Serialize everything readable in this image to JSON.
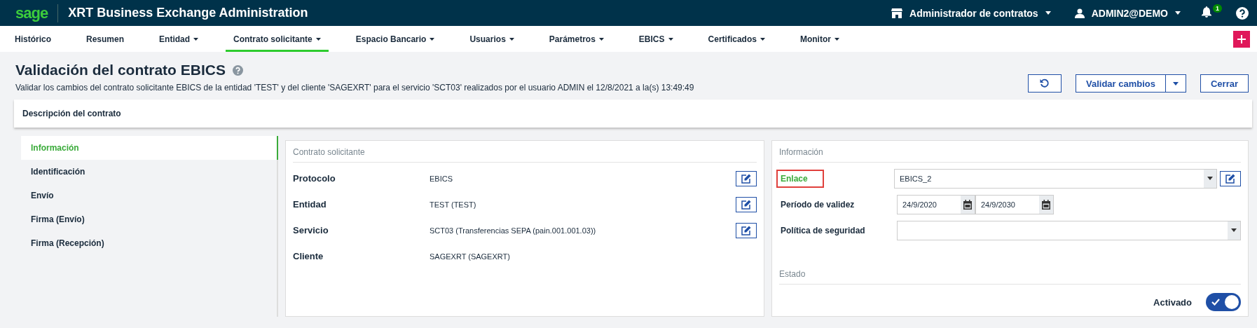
{
  "header": {
    "logo": "sage",
    "title": "XRT Business Exchange Administration",
    "role": "Administrador de contratos",
    "user": "ADMIN2@DEMO",
    "notifications": "1"
  },
  "nav": [
    {
      "label": "Histórico",
      "dropdown": false,
      "selected": false
    },
    {
      "label": "Resumen",
      "dropdown": false,
      "selected": false
    },
    {
      "label": "Entidad",
      "dropdown": true,
      "selected": false
    },
    {
      "label": "Contrato solicitante",
      "dropdown": true,
      "selected": true
    },
    {
      "label": "Espacio Bancario",
      "dropdown": true,
      "selected": false
    },
    {
      "label": "Usuarios",
      "dropdown": true,
      "selected": false
    },
    {
      "label": "Parámetros",
      "dropdown": true,
      "selected": false
    },
    {
      "label": "EBICS",
      "dropdown": true,
      "selected": false
    },
    {
      "label": "Certificados",
      "dropdown": true,
      "selected": false
    },
    {
      "label": "Monitor",
      "dropdown": true,
      "selected": false
    }
  ],
  "page": {
    "title": "Validación del contrato EBICS",
    "subtitle": "Validar los cambios del contrato solicitante EBICS de la entidad 'TEST' y del cliente 'SAGEXRT' para el servicio 'SCT03' realizados por el usuario ADMIN el 12/8/2021 a la(s) 13:49:49",
    "buttons": [
      "Validar cambios",
      "Cerrar"
    ]
  },
  "description": "Descripción del contrato",
  "sidebar": [
    {
      "label": "Información",
      "selected": true
    },
    {
      "label": "Identificación",
      "selected": false
    },
    {
      "label": "Envío",
      "selected": false
    },
    {
      "label": "Firma (Envío)",
      "selected": false
    },
    {
      "label": "Firma (Recepción)",
      "selected": false
    }
  ],
  "contract": {
    "title": "Contrato solicitante",
    "rows": [
      {
        "label": "Protocolo",
        "value": "EBICS",
        "editable": true
      },
      {
        "label": "Entidad",
        "value": "TEST (TEST)",
        "editable": true
      },
      {
        "label": "Servicio",
        "value": "SCT03 (Transferencias SEPA (pain.001.001.03))",
        "editable": true
      },
      {
        "label": "Cliente",
        "value": "SAGEXRT (SAGEXRT)",
        "editable": false
      }
    ]
  },
  "info": {
    "title": "Información",
    "fields": [
      {
        "kind": "select",
        "label": "Enlace",
        "value": "EBICS_2",
        "changed": true,
        "editable": true
      },
      {
        "kind": "dates",
        "label": "Período de validez",
        "from": "24/9/2020",
        "to": "24/9/2030",
        "changed": false
      },
      {
        "kind": "select",
        "label": "Política de seguridad",
        "changed": false,
        "editable": false
      }
    ]
  },
  "status": {
    "title": "Estado",
    "label": "Activado",
    "on": true
  }
}
